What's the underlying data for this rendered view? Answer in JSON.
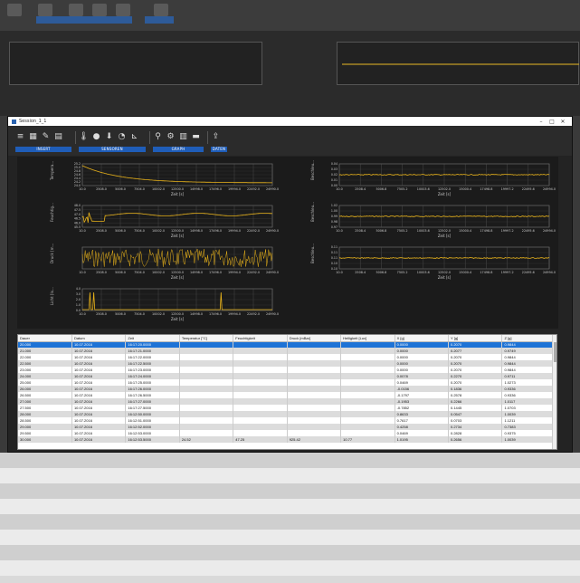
{
  "window": {
    "title": "Session_1_1",
    "controls": {
      "minimize": "–",
      "maximize": "□",
      "close": "✕"
    }
  },
  "ribbon": {
    "groups": [
      {
        "label": "INSERT",
        "buttons": [
          "list-icon",
          "chart-icon",
          "edit-icon",
          "save-icon"
        ]
      },
      {
        "label": "SENSOREN",
        "buttons": [
          "thermometer-icon",
          "drop-icon",
          "probe-icon",
          "gauge-icon",
          "scale-icon"
        ]
      },
      {
        "label": "GRAPH",
        "buttons": [
          "zoom-icon",
          "settings-icon",
          "grid-icon",
          "print-icon"
        ]
      },
      {
        "label": "DATEN",
        "buttons": [
          "export-icon"
        ]
      }
    ],
    "colors": {
      "group_bar": "#1f5db8"
    }
  },
  "plots": {
    "xlabel": "Zeit [s]",
    "series_color": "#e8b21a",
    "left": [
      {
        "ylabel": "Tempera...",
        "xticks": [
          "10.0",
          "2508.0",
          "5006.0",
          "7504.0",
          "10002.0",
          "12500.0",
          "14998.0",
          "17496.0",
          "19994.0",
          "22492.0",
          "24990.0"
        ],
        "yticks": [
          "25.2",
          "25.0",
          "24.8",
          "24.6",
          "24.4",
          "24.2",
          "24.0"
        ]
      },
      {
        "ylabel": "Feuchtig...",
        "xticks": [
          "10.0",
          "2508.0",
          "5006.0",
          "7504.0",
          "10002.0",
          "12500.0",
          "14998.0",
          "17496.0",
          "19994.0",
          "22492.0",
          "24990.0"
        ],
        "yticks": [
          "48.0",
          "47.5",
          "47.0",
          "46.5",
          "46.0",
          "45.5"
        ]
      },
      {
        "ylabel": "Druck [m...",
        "xticks": [
          "10.0",
          "2508.0",
          "5006.0",
          "7504.0",
          "10002.0",
          "12500.0",
          "14998.0",
          "17496.0",
          "19994.0",
          "22492.0",
          "24990.0"
        ],
        "yticks": []
      },
      {
        "ylabel": "Licht [lx...",
        "xticks": [
          "10.0",
          "2508.0",
          "5006.0",
          "7504.0",
          "10002.0",
          "12500.0",
          "14998.0",
          "17496.0",
          "19994.0",
          "22492.0",
          "24990.0"
        ],
        "yticks": [
          "4.0",
          "3.0",
          "2.0",
          "1.0",
          "0.0"
        ]
      }
    ],
    "right": [
      {
        "ylabel": "Beschleu...",
        "xticks": [
          "10.0",
          "2508.4",
          "5006.8",
          "7505.2",
          "10003.6",
          "12502.0",
          "15000.4",
          "17498.8",
          "19997.2",
          "22495.6",
          "24994.0"
        ],
        "yticks": [
          "0.04",
          "0.03",
          "0.02",
          "0.01",
          "0.00"
        ]
      },
      {
        "ylabel": "Beschleu...",
        "xticks": [
          "10.0",
          "2508.4",
          "5006.8",
          "7505.2",
          "10003.6",
          "12502.0",
          "15000.4",
          "17498.8",
          "19997.2",
          "22495.6",
          "24994.0"
        ],
        "yticks": [
          "1.02",
          "1.00",
          "0.99",
          "0.98",
          "0.97"
        ]
      },
      {
        "ylabel": "Beschleu...",
        "xticks": [
          "10.0",
          "2508.4",
          "5006.8",
          "7505.2",
          "10003.6",
          "12502.0",
          "15000.4",
          "17498.8",
          "19997.2",
          "22495.6",
          "24994.0"
        ],
        "yticks": [
          "0.11",
          "0.11",
          "0.11",
          "0.10",
          "0.10"
        ]
      }
    ]
  },
  "table": {
    "columns": [
      "Dauer",
      "Datum",
      "Zeit",
      "Temperatur [°C]",
      "Feuchtigkeit",
      "Druck [mBar]",
      "Helligkeit [Lux]",
      "X [g]",
      "Y [g]",
      "Z [g]"
    ],
    "rows": [
      [
        "20.000",
        "10.07.2016",
        "16:17:20.0000",
        "",
        "",
        "",
        "",
        "0.0000",
        "0.2070",
        "0.9844"
      ],
      [
        "21.000",
        "10.07.2016",
        "16:17:21.0000",
        "",
        "",
        "",
        "",
        "0.0000",
        "0.2077",
        "0.9749"
      ],
      [
        "22.000",
        "10.07.2016",
        "16:17:22.0000",
        "",
        "",
        "",
        "",
        "0.0000",
        "0.2070",
        "0.9844"
      ],
      [
        "22.500",
        "10.07.2016",
        "16:17:22.5000",
        "",
        "",
        "",
        "",
        "0.0000",
        "0.2070",
        "0.9844"
      ],
      [
        "23.000",
        "10.07.2016",
        "16:17:23.0000",
        "",
        "",
        "",
        "",
        "0.0000",
        "0.2070",
        "0.9844"
      ],
      [
        "24.000",
        "10.07.2016",
        "16:17:24.0000",
        "",
        "",
        "",
        "",
        "0.0078",
        "0.2270",
        "0.9711"
      ],
      [
        "25.000",
        "10.07.2016",
        "16:17:25.0000",
        "",
        "",
        "",
        "",
        "0.0469",
        "0.2070",
        "1.0273"
      ],
      [
        "26.000",
        "10.07.2016",
        "16:17:26.0000",
        "",
        "",
        "",
        "",
        "-0.0156",
        "0.1836",
        "0.9336"
      ],
      [
        "26.500",
        "10.07.2016",
        "16:17:26.5000",
        "",
        "",
        "",
        "",
        "-0.1797",
        "0.2578",
        "0.9336"
      ],
      [
        "27.000",
        "10.07.2016",
        "16:17:27.0000",
        "",
        "",
        "",
        "",
        "-0.1953",
        "0.2266",
        "1.0117"
      ],
      [
        "27.500",
        "10.07.2016",
        "16:17:27.5000",
        "",
        "",
        "",
        "",
        "-0.7852",
        "0.1445",
        "1.0703"
      ],
      [
        "28.000",
        "10.07.2016",
        "16:12:50.0000",
        "",
        "",
        "",
        "",
        "0.8633",
        "0.0547",
        "1.0039"
      ],
      [
        "28.500",
        "10.07.2016",
        "16:12:51.0000",
        "",
        "",
        "",
        "",
        "0.7617",
        "0.0703",
        "1.1211"
      ],
      [
        "29.000",
        "10.07.2016",
        "16:12:52.0000",
        "",
        "",
        "",
        "",
        "0.4258",
        "0.2734",
        "0.7383"
      ],
      [
        "29.500",
        "10.07.2016",
        "16:12:53.0000",
        "",
        "",
        "",
        "",
        "0.0469",
        "0.2828",
        "0.9375"
      ],
      [
        "30.000",
        "10.07.2016",
        "16:12:53.5000",
        "24.52",
        "47.25",
        "925.42",
        "10.77",
        "1.0195",
        "0.2656",
        "1.0039"
      ]
    ],
    "selected_index": 0,
    "colors": {
      "selected": "#1e73d6"
    }
  }
}
